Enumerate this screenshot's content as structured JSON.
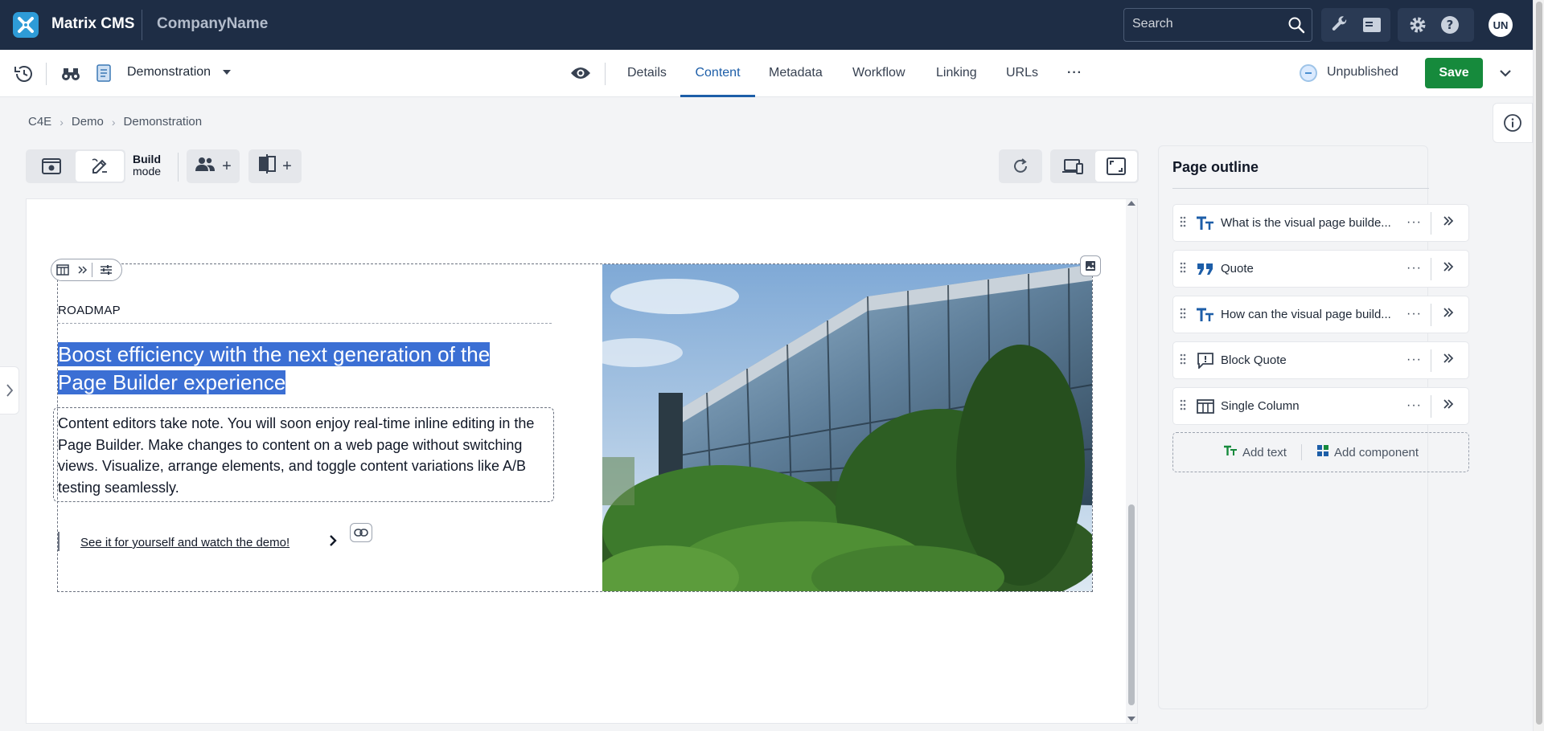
{
  "topbar": {
    "app_name": "Matrix CMS",
    "company": "CompanyName",
    "search_placeholder": "Search",
    "user_initials": "UN"
  },
  "toolbar": {
    "asset_name": "Demonstration",
    "tabs": [
      "Details",
      "Content",
      "Metadata",
      "Workflow",
      "Linking",
      "URLs"
    ],
    "active_tab": "Content",
    "more": "···",
    "status": "Unpublished",
    "save_label": "Save"
  },
  "breadcrumb": [
    "C4E",
    "Demo",
    "Demonstration"
  ],
  "mode": {
    "label_bold": "Build",
    "label": "mode",
    "plus": "+"
  },
  "content": {
    "eyebrow": "ROADMAP",
    "headline_line1": "Boost efficiency with the next generation of the",
    "headline_line2": "Page Builder experience",
    "body": "Content editors take note. You will soon enjoy real-time inline editing in the Page Builder. Make changes to content on a web page without switching views. Visualize, arrange elements, and toggle content variations like A/B testing seamlessly.",
    "cta": "See it for yourself and watch the demo!"
  },
  "outline": {
    "title": "Page outline",
    "items": [
      {
        "icon": "text-icon",
        "label": "What is the visual page builde..."
      },
      {
        "icon": "quote-icon",
        "label": "Quote"
      },
      {
        "icon": "text-icon",
        "label": "How can the visual page build..."
      },
      {
        "icon": "block-quote-icon",
        "label": "Block Quote"
      },
      {
        "icon": "columns-icon",
        "label": "Single Column"
      }
    ],
    "more": "···",
    "add_text": "Add text",
    "add_component": "Add component"
  },
  "colors": {
    "topbar_bg": "#1e2d45",
    "accent": "#1d5ea8",
    "save_green": "#168a3c",
    "selection_blue": "#3b6fd4",
    "logo_blue": "#2e9bd7"
  }
}
